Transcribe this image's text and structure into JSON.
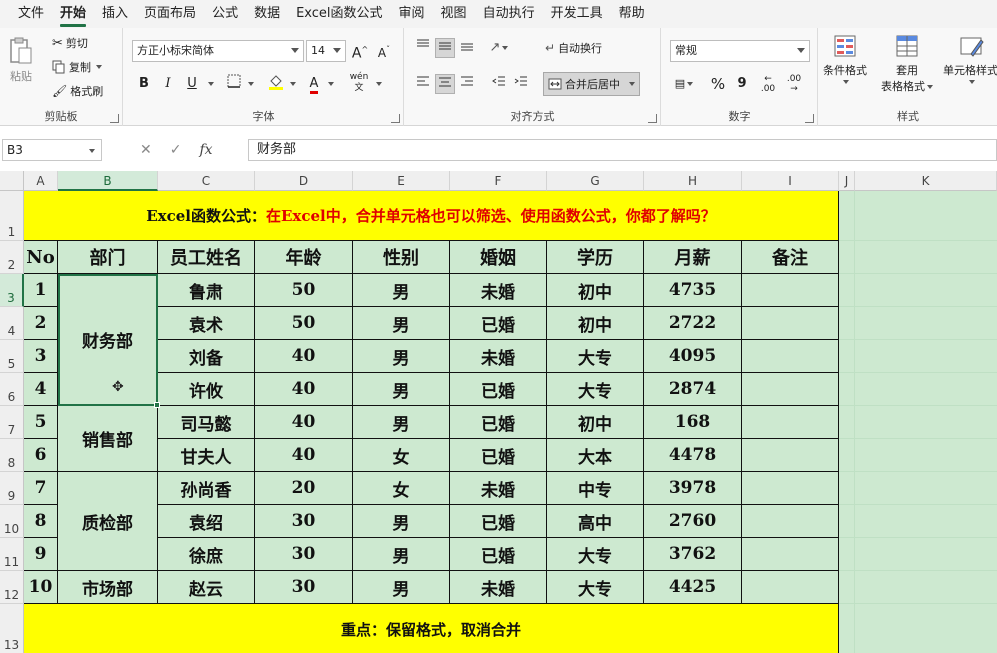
{
  "menu": {
    "tabs": [
      "文件",
      "开始",
      "插入",
      "页面布局",
      "公式",
      "数据",
      "Excel函数公式",
      "审阅",
      "视图",
      "自动执行",
      "开发工具",
      "帮助"
    ],
    "active_index": 1
  },
  "ribbon": {
    "clipboard": {
      "paste": "粘贴",
      "cut": "剪切",
      "copy": "复制",
      "format_painter": "格式刷",
      "label": "剪贴板"
    },
    "font": {
      "font_name": "方正小标宋简体",
      "font_size": "14",
      "bold": "B",
      "italic": "I",
      "underline": "U",
      "grow": "A",
      "shrink": "A",
      "wen": "wén",
      "wen_char": "文",
      "label": "字体"
    },
    "alignment": {
      "wrap_text": "自动换行",
      "merge_center": "合并后居中",
      "label": "对齐方式"
    },
    "number": {
      "format": "常规",
      "percent": "%",
      "comma": "9",
      "inc_decimal": ".00",
      "dec_decimal": ".00",
      "label": "数字"
    },
    "styles": {
      "conditional": "条件格式",
      "table_format_1": "套用",
      "table_format_2": "表格格式",
      "cell_styles": "单元格样式",
      "label": "样式"
    }
  },
  "formula_bar": {
    "name_box": "B3",
    "cancel": "✕",
    "enter": "✓",
    "fx": "fx",
    "content": "财务部"
  },
  "columns": [
    "A",
    "B",
    "C",
    "D",
    "E",
    "F",
    "G",
    "H",
    "I",
    "J",
    "K"
  ],
  "rows": [
    "1",
    "2",
    "3",
    "4",
    "5",
    "6",
    "7",
    "8",
    "9",
    "10",
    "11",
    "12",
    "13"
  ],
  "sheet": {
    "title_black": "Excel函数公式：",
    "title_red": "在Excel中，合并单元格也可以筛选、使用函数公式，你都了解吗？",
    "headers": [
      "No",
      "部门",
      "员工姓名",
      "年龄",
      "性别",
      "婚姻",
      "学历",
      "月薪",
      "备注"
    ],
    "departments": [
      {
        "name": "财务部",
        "rows": 4
      },
      {
        "name": "销售部",
        "rows": 2
      },
      {
        "name": "质检部",
        "rows": 3
      },
      {
        "name": "市场部",
        "rows": 1
      }
    ],
    "records": [
      {
        "no": "1",
        "name": "鲁肃",
        "age": "50",
        "gender": "男",
        "marital": "未婚",
        "edu": "初中",
        "salary": "4735",
        "note": ""
      },
      {
        "no": "2",
        "name": "袁术",
        "age": "50",
        "gender": "男",
        "marital": "已婚",
        "edu": "初中",
        "salary": "2722",
        "note": ""
      },
      {
        "no": "3",
        "name": "刘备",
        "age": "40",
        "gender": "男",
        "marital": "未婚",
        "edu": "大专",
        "salary": "4095",
        "note": ""
      },
      {
        "no": "4",
        "name": "许攸",
        "age": "40",
        "gender": "男",
        "marital": "已婚",
        "edu": "大专",
        "salary": "2874",
        "note": ""
      },
      {
        "no": "5",
        "name": "司马懿",
        "age": "40",
        "gender": "男",
        "marital": "已婚",
        "edu": "初中",
        "salary": "168",
        "note": ""
      },
      {
        "no": "6",
        "name": "甘夫人",
        "age": "40",
        "gender": "女",
        "marital": "已婚",
        "edu": "大本",
        "salary": "4478",
        "note": ""
      },
      {
        "no": "7",
        "name": "孙尚香",
        "age": "20",
        "gender": "女",
        "marital": "未婚",
        "edu": "中专",
        "salary": "3978",
        "note": ""
      },
      {
        "no": "8",
        "name": "袁绍",
        "age": "30",
        "gender": "男",
        "marital": "已婚",
        "edu": "高中",
        "salary": "2760",
        "note": ""
      },
      {
        "no": "9",
        "name": "徐庶",
        "age": "30",
        "gender": "男",
        "marital": "已婚",
        "edu": "大专",
        "salary": "3762",
        "note": ""
      },
      {
        "no": "10",
        "name": "赵云",
        "age": "30",
        "gender": "男",
        "marital": "未婚",
        "edu": "大专",
        "salary": "4425",
        "note": ""
      }
    ],
    "footer_black": "重点：",
    "footer_red": "保留格式，取消合并"
  },
  "colors": {
    "accent": "#217346",
    "title_bg": "#ffff00",
    "table_bg": "#cde9d0",
    "red_text": "#e00000"
  },
  "icons": {
    "cursor": "plus-cursor-icon"
  }
}
